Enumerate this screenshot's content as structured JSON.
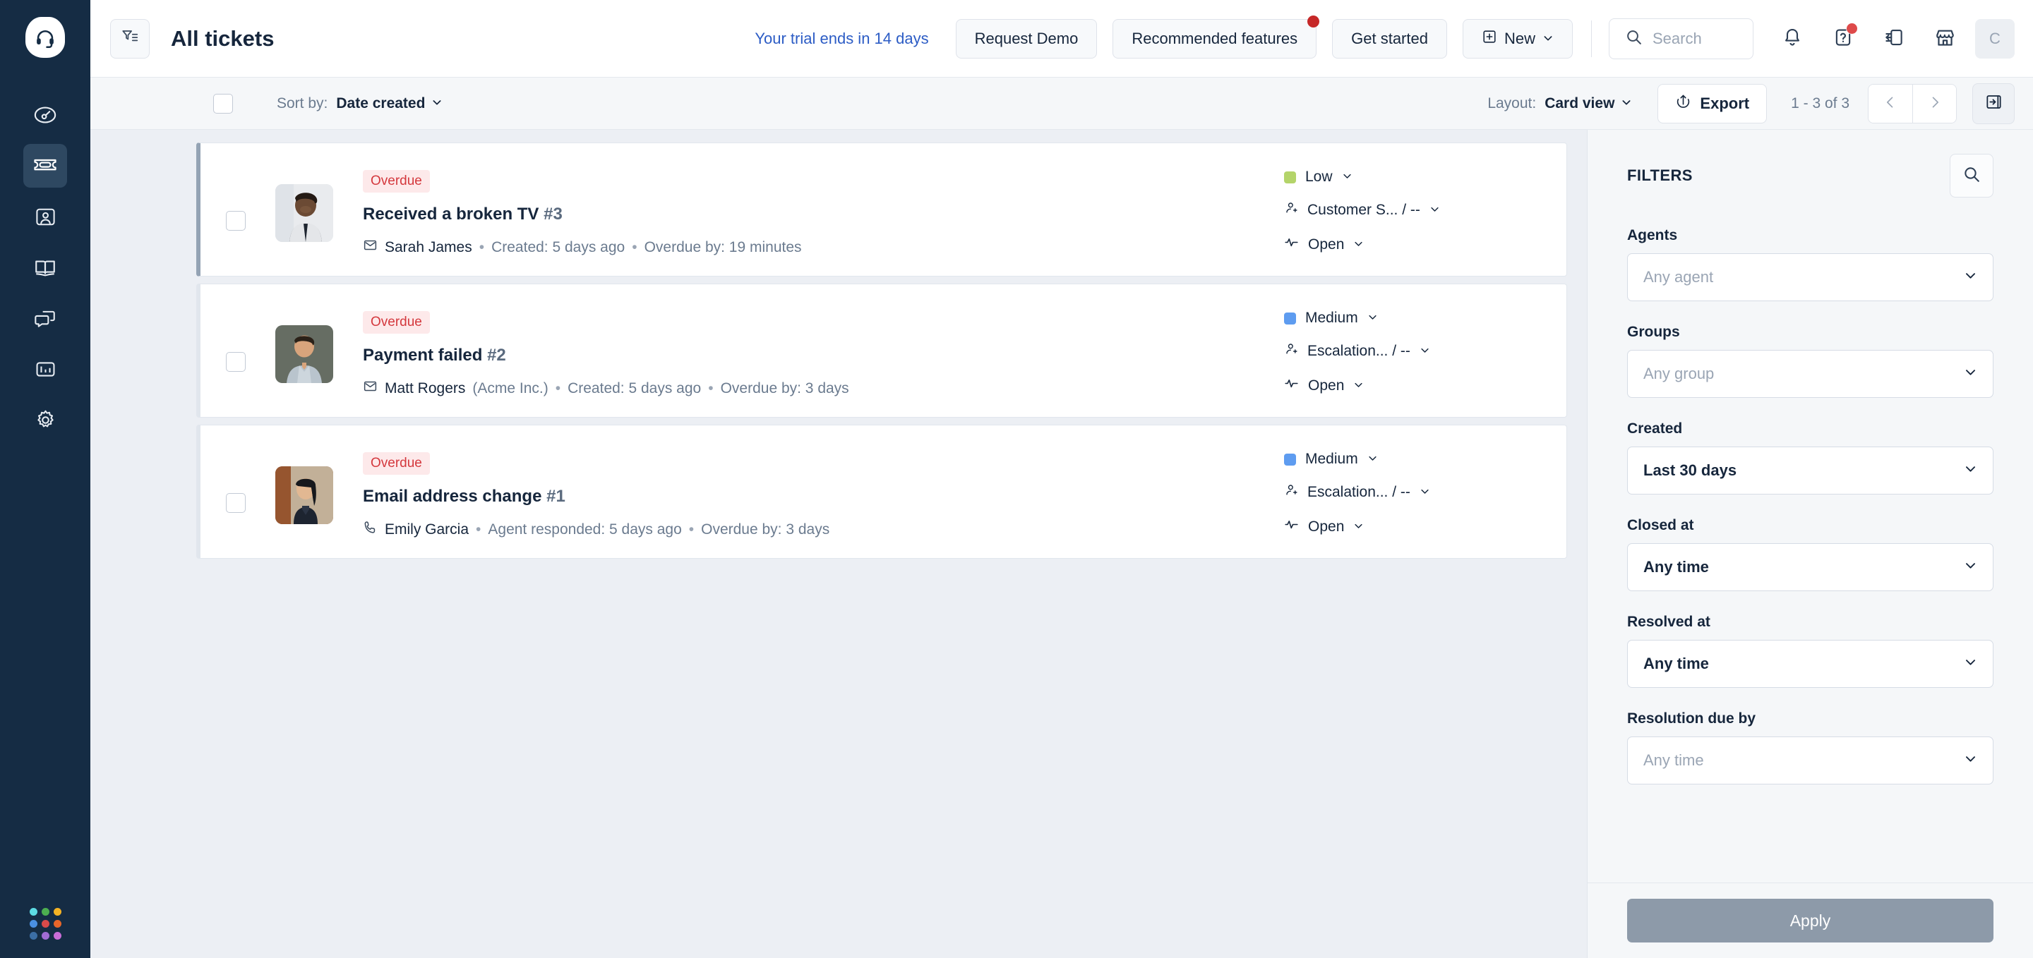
{
  "brand": {
    "accent": "#2c5cc5",
    "rail_bg": "#152c44",
    "overdue_bg": "#fde9ea",
    "overdue_fg": "#d4383d"
  },
  "sidebar": {
    "logo_icon": "headset-logo-icon",
    "items": [
      {
        "icon": "dashboard-icon",
        "name": "dashboard",
        "active": false
      },
      {
        "icon": "ticket-icon",
        "name": "tickets",
        "active": true
      },
      {
        "icon": "contacts-icon",
        "name": "contacts",
        "active": false
      },
      {
        "icon": "knowledge-base-icon",
        "name": "knowledge-base",
        "active": false
      },
      {
        "icon": "social-chat-icon",
        "name": "social",
        "active": false
      },
      {
        "icon": "analytics-icon",
        "name": "analytics",
        "active": false
      },
      {
        "icon": "settings-gear-icon",
        "name": "admin",
        "active": false
      }
    ],
    "bottom": {
      "icon": "app-grid-icon",
      "dot_colors": [
        "#5ddce4",
        "#4caf50",
        "#f5b324",
        "#4a90e2",
        "#d94a4a",
        "#e8662a",
        "#3b6ea5",
        "#a06cd5",
        "#c96dd8"
      ]
    }
  },
  "header": {
    "filter_toggle_icon": "filter-list-icon",
    "title": "All tickets",
    "trial_text": "Your trial ends in 14 days",
    "request_demo_label": "Request Demo",
    "recommended_features_label": "Recommended features",
    "recommended_has_badge": true,
    "get_started_label": "Get started",
    "new_label": "New",
    "new_icon": "plus-square-icon",
    "search": {
      "placeholder": "Search",
      "value": "",
      "icon": "search-icon"
    },
    "icons": [
      {
        "name": "notifications-bell-icon",
        "badge": false
      },
      {
        "name": "help-question-icon",
        "badge": true
      },
      {
        "name": "what-is-new-icon",
        "badge": false
      },
      {
        "name": "marketplace-store-icon",
        "badge": false
      }
    ],
    "avatar_initial": "C"
  },
  "toolbar": {
    "select_all_checked": false,
    "sort_label": "Sort by:",
    "sort_value": "Date created",
    "layout_label": "Layout:",
    "layout_value": "Card view",
    "export_label": "Export",
    "export_icon": "export-upload-icon",
    "pagination": "1 - 3 of 3",
    "prev_icon": "chevron-left-icon",
    "next_icon": "chevron-right-icon",
    "panel_toggle_icon": "collapse-panel-icon"
  },
  "tickets": [
    {
      "tag": "Overdue",
      "title": "Received a broken TV",
      "number": "#3",
      "channel_icon": "email-icon",
      "requester": "Sarah James",
      "company": "",
      "activity": "Created: 5 days ago",
      "overdue": "Overdue by: 19 minutes",
      "priority": "Low",
      "priority_color": "#b4d46a",
      "group": "Customer S... / --",
      "status": "Open",
      "avatar_alt": "sarah-james-avatar",
      "avatar_colors": [
        "#e8e9ec",
        "#3b2b24"
      ]
    },
    {
      "tag": "Overdue",
      "title": "Payment failed",
      "number": "#2",
      "channel_icon": "email-icon",
      "requester": "Matt Rogers",
      "company": "(Acme Inc.)",
      "activity": "Created: 5 days ago",
      "overdue": "Overdue by: 3 days",
      "priority": "Medium",
      "priority_color": "#5e9cf0",
      "group": "Escalation... / --",
      "status": "Open",
      "avatar_alt": "matt-rogers-avatar",
      "avatar_colors": [
        "#6a7168",
        "#b9c4cd"
      ]
    },
    {
      "tag": "Overdue",
      "title": "Email address change",
      "number": "#1",
      "channel_icon": "phone-icon",
      "requester": "Emily Garcia",
      "company": "",
      "activity": "Agent responded: 5 days ago",
      "overdue": "Overdue by: 3 days",
      "priority": "Medium",
      "priority_color": "#5e9cf0",
      "group": "Escalation... / --",
      "status": "Open",
      "avatar_alt": "emily-garcia-avatar",
      "avatar_colors": [
        "#a8653f",
        "#1d2430"
      ]
    }
  ],
  "filters": {
    "title": "FILTERS",
    "search_icon": "search-icon",
    "groups": [
      {
        "label": "Agents",
        "value": "Any agent",
        "placeholder": true
      },
      {
        "label": "Groups",
        "value": "Any group",
        "placeholder": true
      },
      {
        "label": "Created",
        "value": "Last 30 days",
        "placeholder": false
      },
      {
        "label": "Closed at",
        "value": "Any time",
        "placeholder": false
      },
      {
        "label": "Resolved at",
        "value": "Any time",
        "placeholder": false
      },
      {
        "label": "Resolution due by",
        "value": "Any time",
        "placeholder": true
      }
    ],
    "apply_label": "Apply"
  }
}
